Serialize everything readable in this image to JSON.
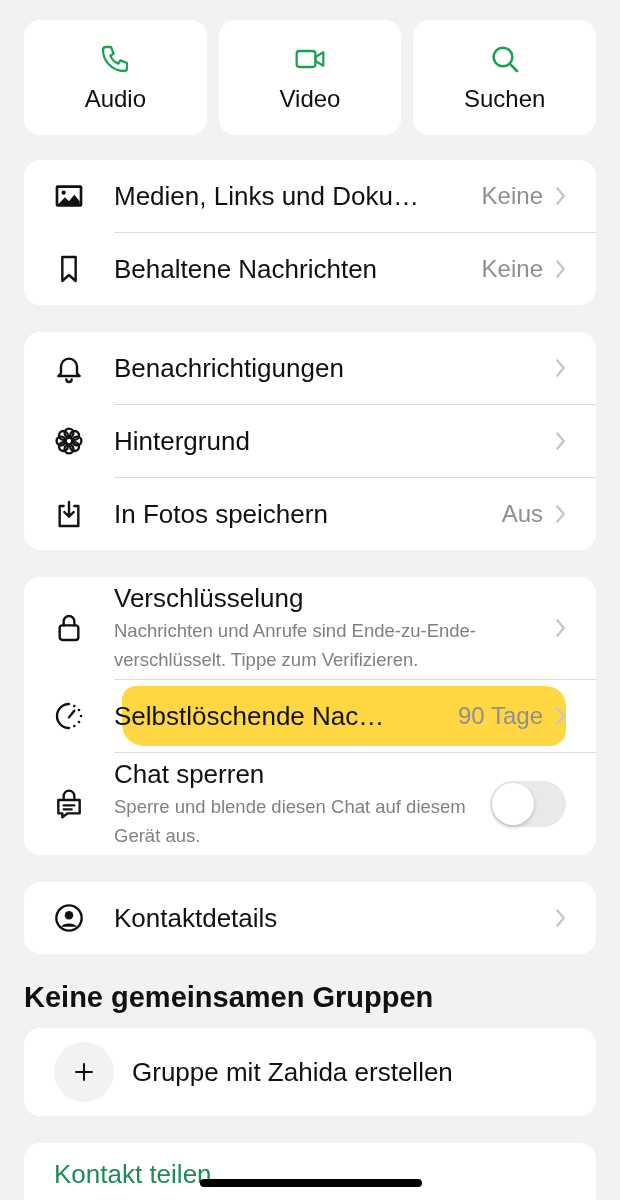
{
  "actions": [
    {
      "label": "Audio"
    },
    {
      "label": "Video"
    },
    {
      "label": "Suchen"
    }
  ],
  "sections": [
    {
      "rows": [
        {
          "kind": "nav",
          "label": "Medien, Links und Doku…",
          "value": "Keine"
        },
        {
          "kind": "nav",
          "label": "Behaltene Nachrichten",
          "value": "Keine"
        }
      ]
    },
    {
      "rows": [
        {
          "kind": "nav",
          "label": "Benachrichtigungen"
        },
        {
          "kind": "nav",
          "label": "Hintergrund"
        },
        {
          "kind": "nav",
          "label": "In Fotos speichern",
          "value": "Aus"
        }
      ]
    },
    {
      "rows": [
        {
          "kind": "nav",
          "label": "Verschlüsselung",
          "subtitle": "Nachrichten und Anrufe sind Ende-zu-Ende-verschlüsselt. Tippe zum Verifizieren."
        },
        {
          "kind": "nav",
          "label": "Selbstlöschende Nac…",
          "value": "90 Tage",
          "highlighted": true
        },
        {
          "kind": "toggle",
          "label": "Chat sperren",
          "subtitle": "Sperre und blende diesen Chat auf diesem Gerät aus.",
          "on": false
        }
      ]
    },
    {
      "rows": [
        {
          "kind": "nav",
          "label": "Kontaktdetails"
        }
      ]
    }
  ],
  "groups": {
    "heading": "Keine gemeinsamen Gruppen",
    "create_label": "Gruppe mit Zahida erstellen"
  },
  "share_contact": {
    "label": "Kontakt teilen"
  }
}
